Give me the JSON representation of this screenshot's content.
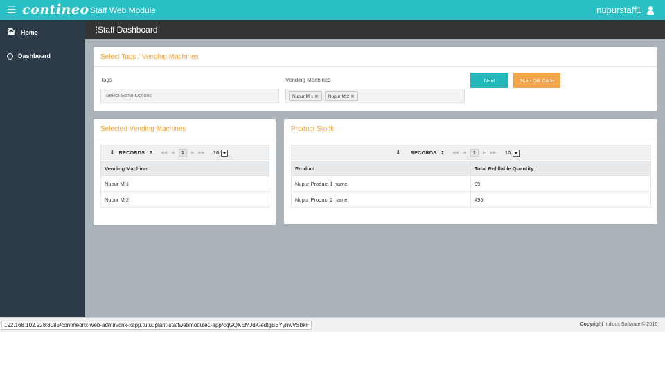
{
  "topbar": {
    "logo": "contineo",
    "module_title": "Staff Web Module",
    "username": "nupurstaff1"
  },
  "sidebar": {
    "items": [
      {
        "label": "Home",
        "icon": "home-icon"
      },
      {
        "label": "Dashboard",
        "icon": "circle-icon"
      }
    ]
  },
  "page": {
    "title": "Staff Dashboard"
  },
  "select_panel": {
    "title": "Select Tags / Vending Machines",
    "tags_label": "Tags",
    "tags_placeholder": "Select Some Options",
    "vm_label": "Vending Machines",
    "vm_chips": [
      "Nupur M 1",
      "Nupur M 2"
    ],
    "next_label": "Next",
    "scan_label": "Scan QR Code"
  },
  "vm_panel": {
    "title": "Selected Vending Machines",
    "records_label": "RECORDS : 2",
    "page_number": "1",
    "page_size": "10",
    "column": "Vending Machine",
    "rows": [
      "Nupur M 1",
      "Nupur M 2"
    ]
  },
  "stock_panel": {
    "title": "Product Stock",
    "records_label": "RECORDS : 2",
    "page_number": "1",
    "page_size": "10",
    "columns": [
      "Product",
      "Total Refillable Quantity"
    ],
    "rows": [
      {
        "product": "Nupur Product 1 name",
        "qty": "99"
      },
      {
        "product": "Nupur Product 2 name",
        "qty": "495"
      }
    ]
  },
  "statusbar": {
    "url": "192.168.102.228:8085/contineonx-web-admin/cnx-xapp.tutuuplant-staffwebmodule1-app/cqGQKEMJdKIedtgBBYynwVSbk#",
    "copyright_label": "Copyright",
    "copyright_text": "Indicus Software © 2016"
  },
  "colors": {
    "topbar": "#2ac1c6",
    "sidebar": "#2d3a48",
    "accent_orange": "#f7a43b",
    "next_button": "#23b7b9",
    "scan_button": "#f4a54a"
  }
}
